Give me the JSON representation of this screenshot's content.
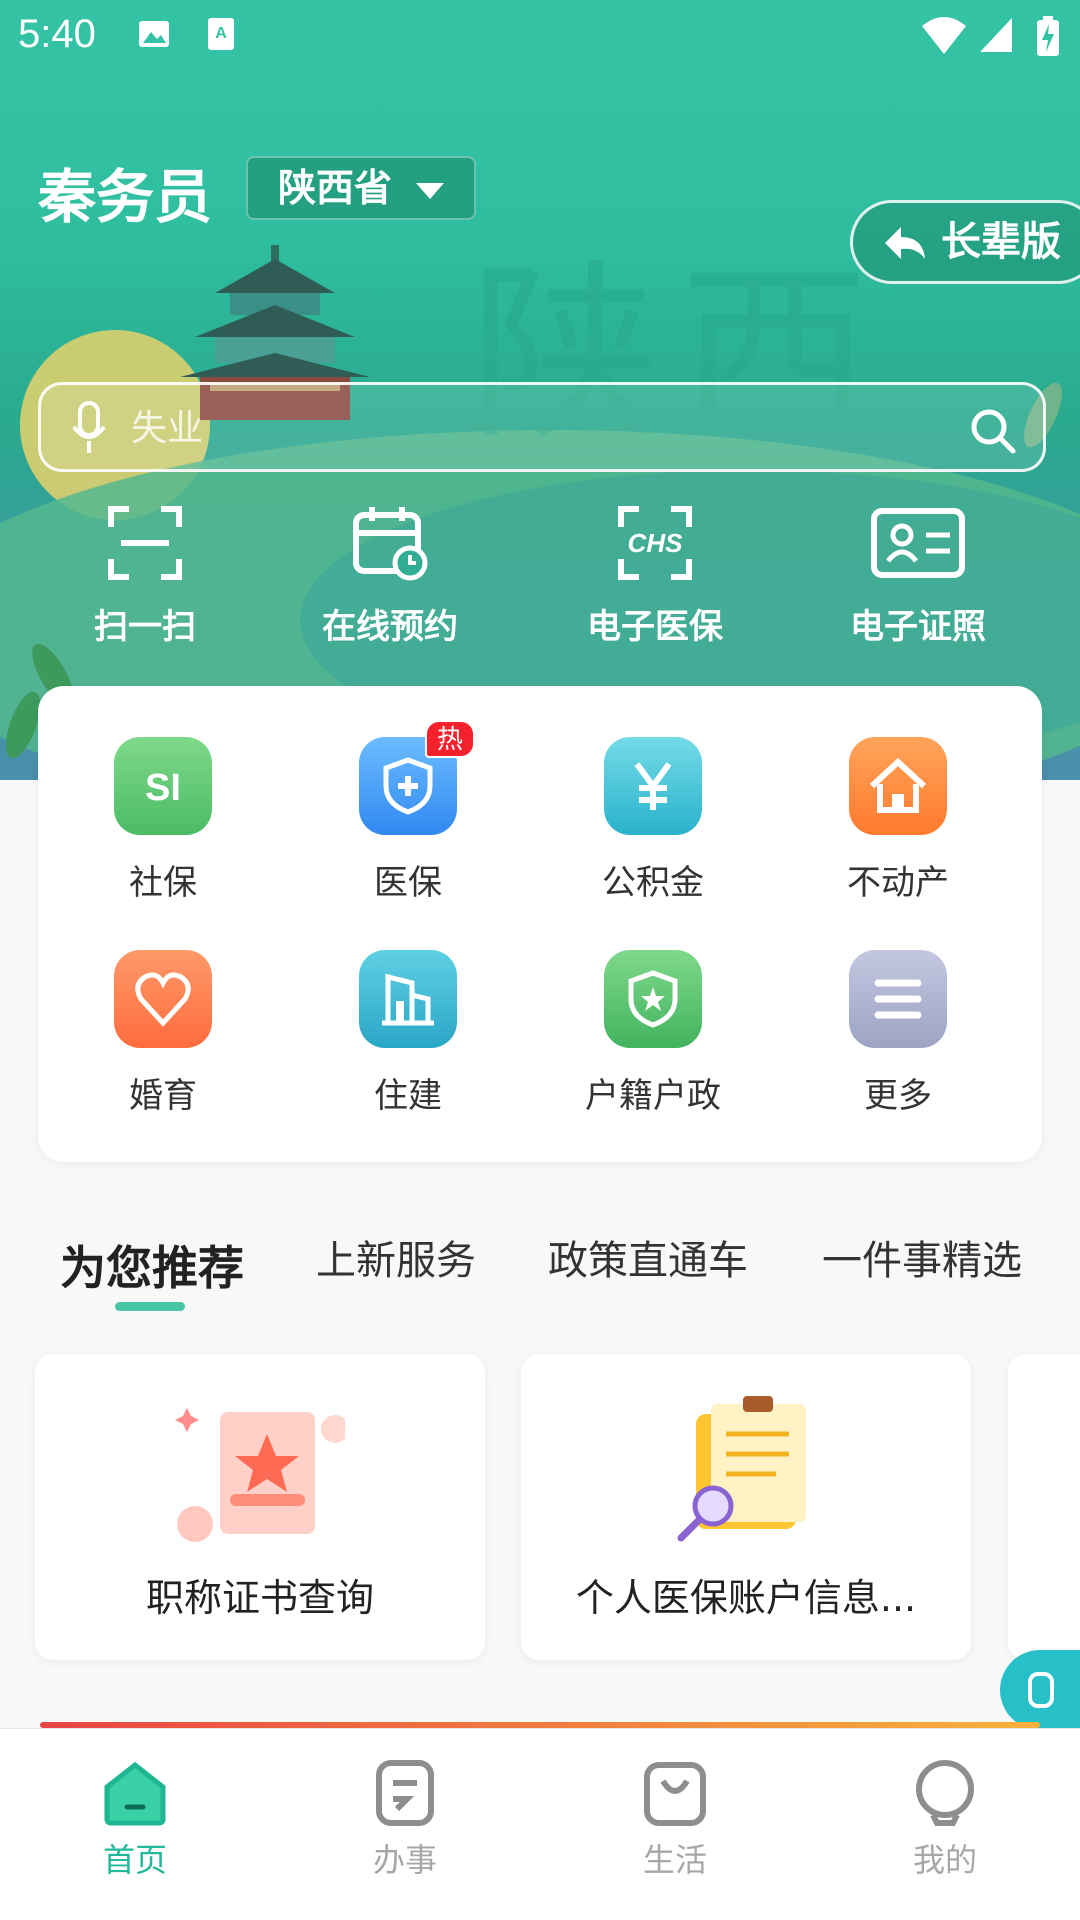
{
  "status_bar": {
    "time": "5:40"
  },
  "header": {
    "app_title": "秦务员",
    "province": "陕西省",
    "elder_mode": "长辈版",
    "watermark": "陕西"
  },
  "search": {
    "placeholder": "失业"
  },
  "quick_actions": [
    {
      "label": "扫一扫",
      "icon": "scan-icon"
    },
    {
      "label": "在线预约",
      "icon": "calendar-clock-icon"
    },
    {
      "label": "电子医保",
      "icon": "chs-icon"
    },
    {
      "label": "电子证照",
      "icon": "id-card-icon"
    }
  ],
  "services": [
    {
      "label": "社保",
      "icon": "si-icon",
      "color": "#5cc46f"
    },
    {
      "label": "医保",
      "icon": "shield-plus-icon",
      "color": "#3d9df6",
      "badge": "热"
    },
    {
      "label": "公积金",
      "icon": "yen-icon",
      "color": "#3fc4d6"
    },
    {
      "label": "不动产",
      "icon": "house-icon",
      "color": "#ff8a3d"
    },
    {
      "label": "婚育",
      "icon": "heart-icon",
      "color": "#ff7a4e"
    },
    {
      "label": "住建",
      "icon": "building-icon",
      "color": "#32b7d0"
    },
    {
      "label": "户籍户政",
      "icon": "shield-star-icon",
      "color": "#5cc46f"
    },
    {
      "label": "更多",
      "icon": "menu-icon",
      "color": "#a5aac9"
    }
  ],
  "tabs": [
    "为您推荐",
    "上新服务",
    "政策直通车",
    "一件事精选"
  ],
  "recommendations": [
    {
      "title": "职称证书查询"
    },
    {
      "title": "个人医保账户信息..."
    }
  ],
  "bottom_nav": [
    {
      "label": "首页",
      "icon": "home-icon",
      "active": true
    },
    {
      "label": "办事",
      "icon": "document-icon"
    },
    {
      "label": "生活",
      "icon": "shopping-bag-icon"
    },
    {
      "label": "我的",
      "icon": "profile-icon"
    }
  ],
  "colors": {
    "accent": "#22b89a",
    "hot_badge": "#f5222d"
  }
}
